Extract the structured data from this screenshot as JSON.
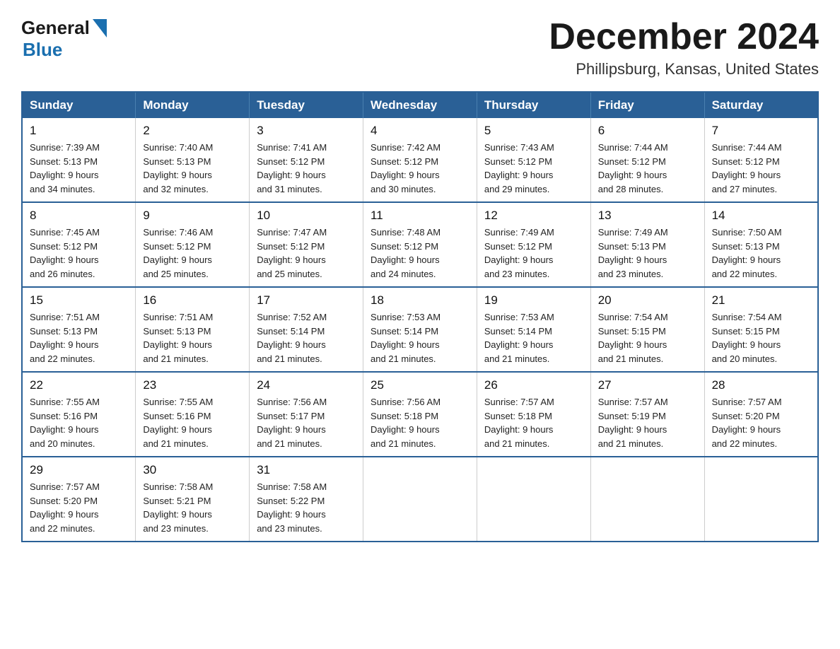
{
  "header": {
    "logo_general": "General",
    "logo_blue": "Blue",
    "month_title": "December 2024",
    "location": "Phillipsburg, Kansas, United States"
  },
  "weekdays": [
    "Sunday",
    "Monday",
    "Tuesday",
    "Wednesday",
    "Thursday",
    "Friday",
    "Saturday"
  ],
  "weeks": [
    [
      {
        "day": "1",
        "sunrise": "7:39 AM",
        "sunset": "5:13 PM",
        "daylight": "9 hours and 34 minutes."
      },
      {
        "day": "2",
        "sunrise": "7:40 AM",
        "sunset": "5:13 PM",
        "daylight": "9 hours and 32 minutes."
      },
      {
        "day": "3",
        "sunrise": "7:41 AM",
        "sunset": "5:12 PM",
        "daylight": "9 hours and 31 minutes."
      },
      {
        "day": "4",
        "sunrise": "7:42 AM",
        "sunset": "5:12 PM",
        "daylight": "9 hours and 30 minutes."
      },
      {
        "day": "5",
        "sunrise": "7:43 AM",
        "sunset": "5:12 PM",
        "daylight": "9 hours and 29 minutes."
      },
      {
        "day": "6",
        "sunrise": "7:44 AM",
        "sunset": "5:12 PM",
        "daylight": "9 hours and 28 minutes."
      },
      {
        "day": "7",
        "sunrise": "7:44 AM",
        "sunset": "5:12 PM",
        "daylight": "9 hours and 27 minutes."
      }
    ],
    [
      {
        "day": "8",
        "sunrise": "7:45 AM",
        "sunset": "5:12 PM",
        "daylight": "9 hours and 26 minutes."
      },
      {
        "day": "9",
        "sunrise": "7:46 AM",
        "sunset": "5:12 PM",
        "daylight": "9 hours and 25 minutes."
      },
      {
        "day": "10",
        "sunrise": "7:47 AM",
        "sunset": "5:12 PM",
        "daylight": "9 hours and 25 minutes."
      },
      {
        "day": "11",
        "sunrise": "7:48 AM",
        "sunset": "5:12 PM",
        "daylight": "9 hours and 24 minutes."
      },
      {
        "day": "12",
        "sunrise": "7:49 AM",
        "sunset": "5:12 PM",
        "daylight": "9 hours and 23 minutes."
      },
      {
        "day": "13",
        "sunrise": "7:49 AM",
        "sunset": "5:13 PM",
        "daylight": "9 hours and 23 minutes."
      },
      {
        "day": "14",
        "sunrise": "7:50 AM",
        "sunset": "5:13 PM",
        "daylight": "9 hours and 22 minutes."
      }
    ],
    [
      {
        "day": "15",
        "sunrise": "7:51 AM",
        "sunset": "5:13 PM",
        "daylight": "9 hours and 22 minutes."
      },
      {
        "day": "16",
        "sunrise": "7:51 AM",
        "sunset": "5:13 PM",
        "daylight": "9 hours and 21 minutes."
      },
      {
        "day": "17",
        "sunrise": "7:52 AM",
        "sunset": "5:14 PM",
        "daylight": "9 hours and 21 minutes."
      },
      {
        "day": "18",
        "sunrise": "7:53 AM",
        "sunset": "5:14 PM",
        "daylight": "9 hours and 21 minutes."
      },
      {
        "day": "19",
        "sunrise": "7:53 AM",
        "sunset": "5:14 PM",
        "daylight": "9 hours and 21 minutes."
      },
      {
        "day": "20",
        "sunrise": "7:54 AM",
        "sunset": "5:15 PM",
        "daylight": "9 hours and 21 minutes."
      },
      {
        "day": "21",
        "sunrise": "7:54 AM",
        "sunset": "5:15 PM",
        "daylight": "9 hours and 20 minutes."
      }
    ],
    [
      {
        "day": "22",
        "sunrise": "7:55 AM",
        "sunset": "5:16 PM",
        "daylight": "9 hours and 20 minutes."
      },
      {
        "day": "23",
        "sunrise": "7:55 AM",
        "sunset": "5:16 PM",
        "daylight": "9 hours and 21 minutes."
      },
      {
        "day": "24",
        "sunrise": "7:56 AM",
        "sunset": "5:17 PM",
        "daylight": "9 hours and 21 minutes."
      },
      {
        "day": "25",
        "sunrise": "7:56 AM",
        "sunset": "5:18 PM",
        "daylight": "9 hours and 21 minutes."
      },
      {
        "day": "26",
        "sunrise": "7:57 AM",
        "sunset": "5:18 PM",
        "daylight": "9 hours and 21 minutes."
      },
      {
        "day": "27",
        "sunrise": "7:57 AM",
        "sunset": "5:19 PM",
        "daylight": "9 hours and 21 minutes."
      },
      {
        "day": "28",
        "sunrise": "7:57 AM",
        "sunset": "5:20 PM",
        "daylight": "9 hours and 22 minutes."
      }
    ],
    [
      {
        "day": "29",
        "sunrise": "7:57 AM",
        "sunset": "5:20 PM",
        "daylight": "9 hours and 22 minutes."
      },
      {
        "day": "30",
        "sunrise": "7:58 AM",
        "sunset": "5:21 PM",
        "daylight": "9 hours and 23 minutes."
      },
      {
        "day": "31",
        "sunrise": "7:58 AM",
        "sunset": "5:22 PM",
        "daylight": "9 hours and 23 minutes."
      },
      null,
      null,
      null,
      null
    ]
  ],
  "labels": {
    "sunrise": "Sunrise:",
    "sunset": "Sunset:",
    "daylight": "Daylight:"
  }
}
